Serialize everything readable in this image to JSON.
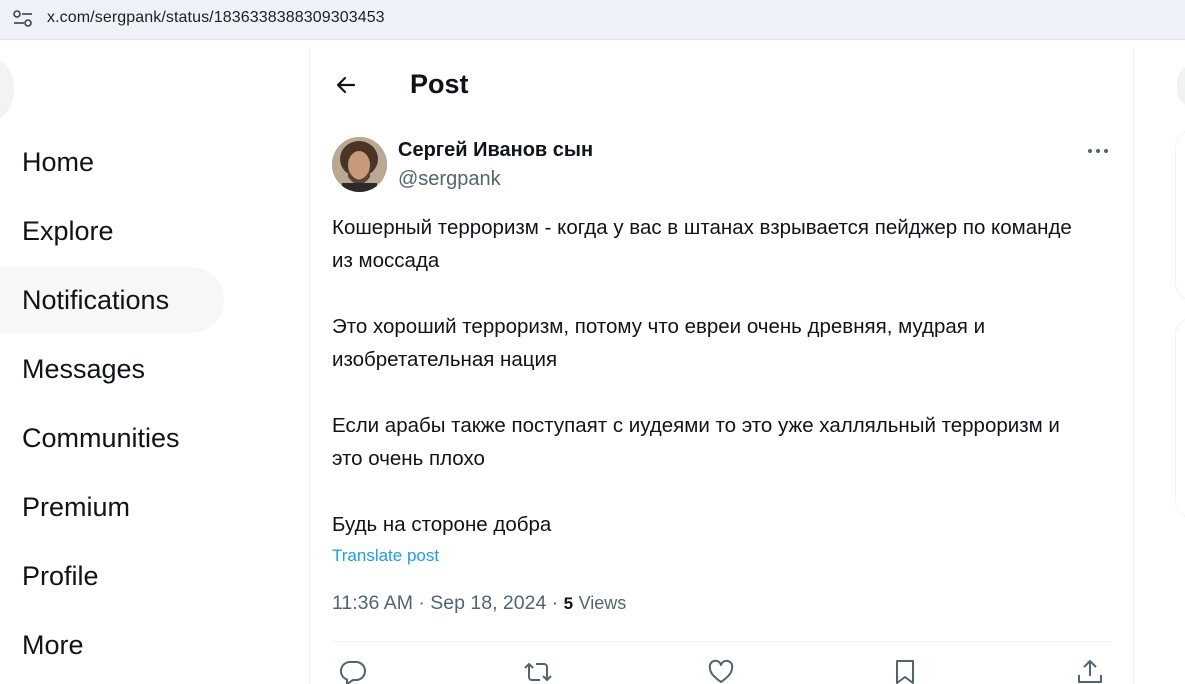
{
  "browser": {
    "url": "x.com/sergpank/status/1836338388309303453"
  },
  "nav": {
    "items": [
      {
        "label": "Home"
      },
      {
        "label": "Explore"
      },
      {
        "label": "Notifications"
      },
      {
        "label": "Messages"
      },
      {
        "label": "Communities"
      },
      {
        "label": "Premium"
      },
      {
        "label": "Profile"
      },
      {
        "label": "More"
      }
    ],
    "hovered": "Notifications"
  },
  "header": {
    "title": "Post"
  },
  "post": {
    "author_name": "Сергей Иванов сын",
    "author_handle": "@sergpank",
    "paragraphs": [
      "Кошерный терроризм - когда у вас в штанах взрывается пейджер по команде из моссада",
      "Это хороший терроризм, потому что евреи очень древняя, мудрая и изобретательная нация",
      "Если арабы также поступаят с иудеями то это уже халляльный терроризм и это очень плохо",
      "Будь на стороне добра"
    ],
    "translate_label": "Translate post",
    "time": "11:36 AM",
    "date": "Sep 18, 2024",
    "separator": "·",
    "views_count": "5",
    "views_label": "Views"
  },
  "actions": [
    {
      "icon": "reply-icon"
    },
    {
      "icon": "repost-icon"
    },
    {
      "icon": "like-icon"
    },
    {
      "icon": "bookmark-icon"
    },
    {
      "icon": "share-icon"
    }
  ],
  "colors": {
    "accent": "#1d9bf0",
    "secondary_text": "#536471",
    "primary_text": "#0f1419"
  }
}
